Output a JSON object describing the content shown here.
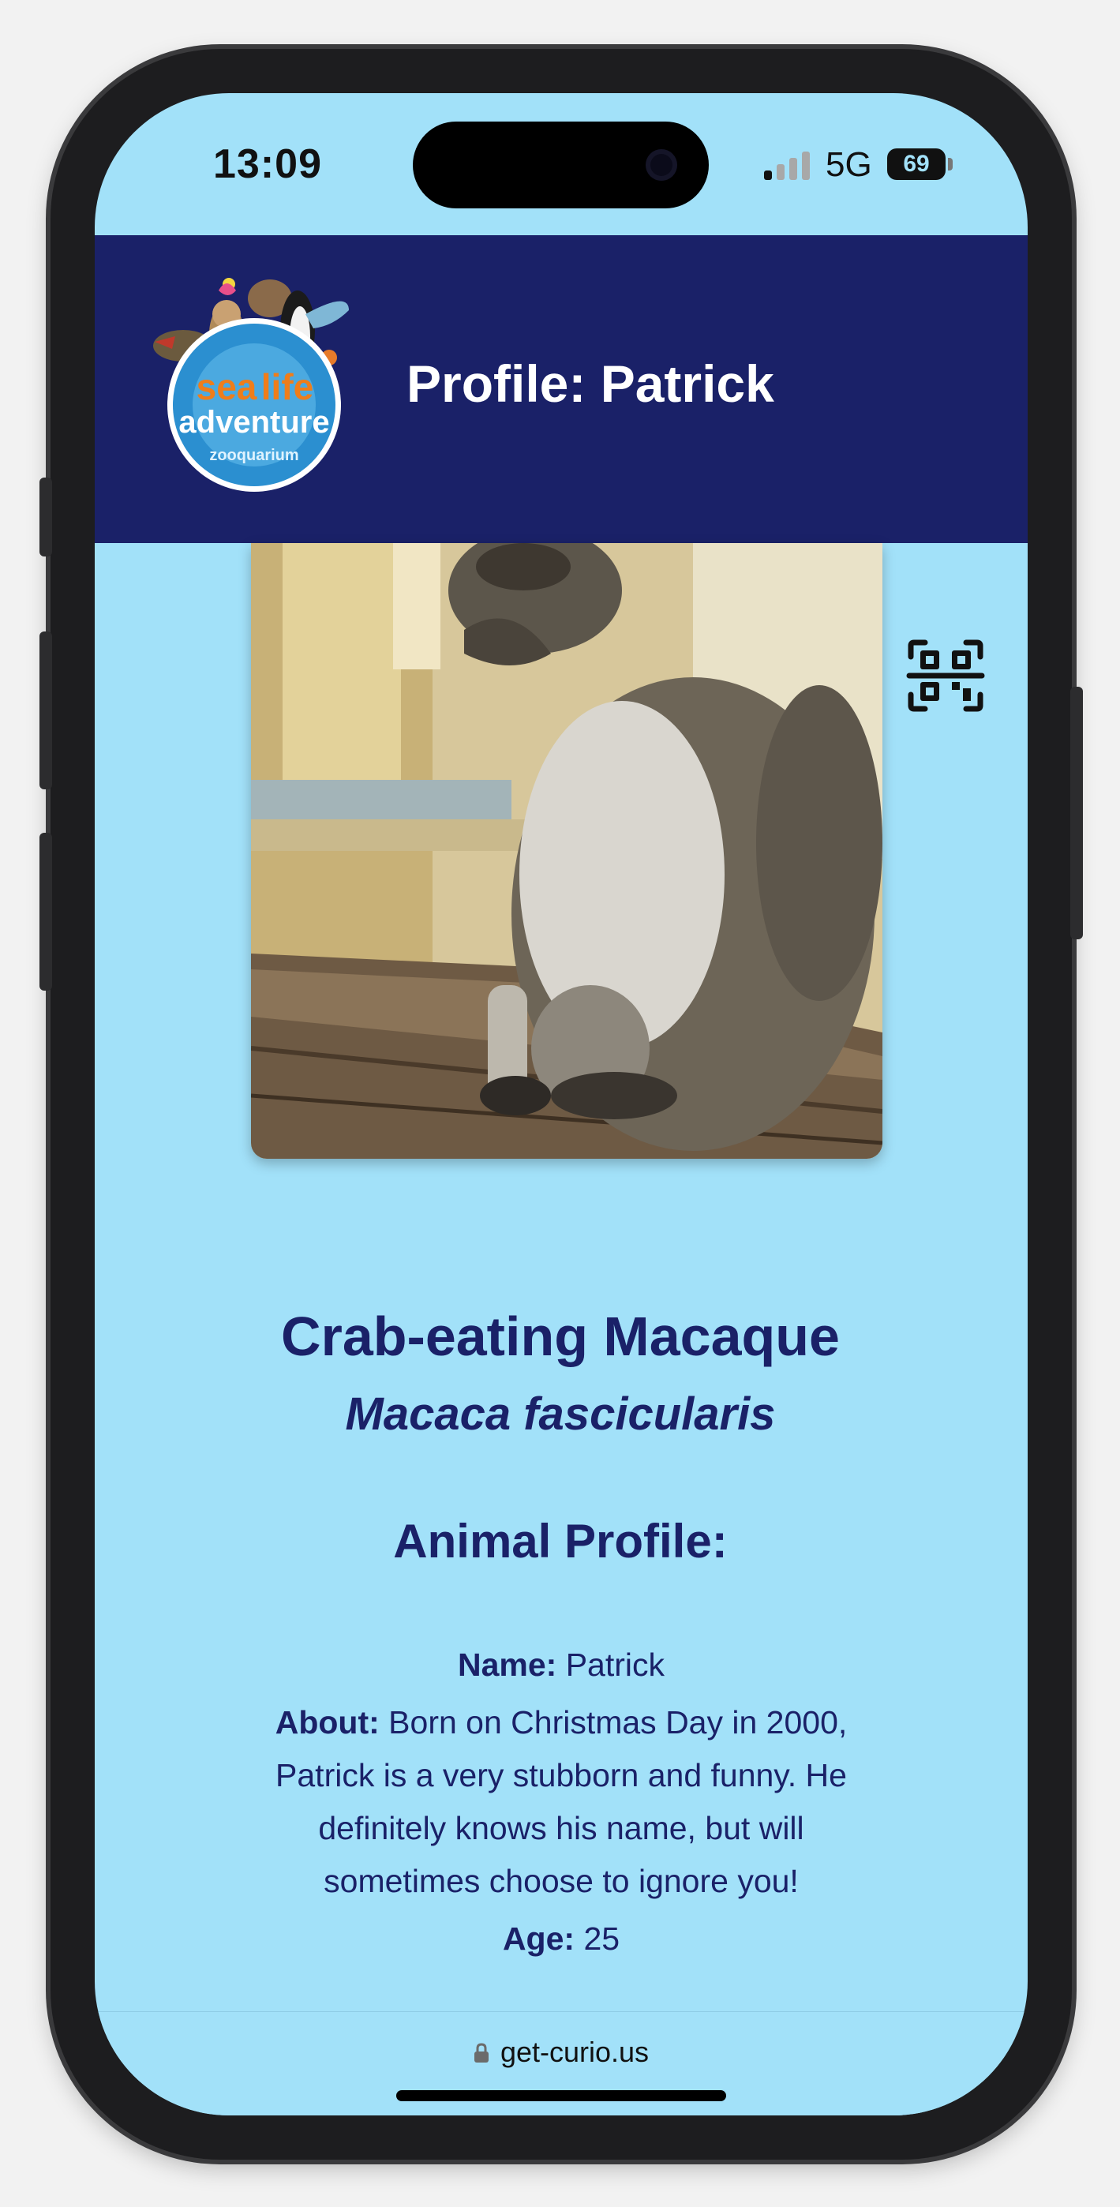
{
  "status_bar": {
    "time": "13:09",
    "network": "5G",
    "battery": "69"
  },
  "header": {
    "title": "Profile: Patrick",
    "logo": {
      "line1": "sea",
      "line1b": "life",
      "line2": "adventure",
      "line3": "zooquarium"
    },
    "color": "#1a2168"
  },
  "animal": {
    "common_name": "Crab-eating Macaque",
    "scientific_name": "Macaca fascicularis"
  },
  "profile": {
    "heading": "Animal Profile:",
    "name_label": "Name:",
    "name_value": " Patrick",
    "about_label": "About:",
    "about_value": " Born on Christmas Day in 2000, Patrick is a very stubborn and funny. He definitely knows his name, but will sometimes choose to ignore you!",
    "age_label": "Age:",
    "age_value": " 25"
  },
  "browser": {
    "url": "get-curio.us"
  },
  "icons": {
    "qr": "qr-code-icon",
    "lock": "lock-icon"
  },
  "colors": {
    "page_bg": "#a2e1f9",
    "header_bg": "#1a2168",
    "text": "#1a2168"
  }
}
